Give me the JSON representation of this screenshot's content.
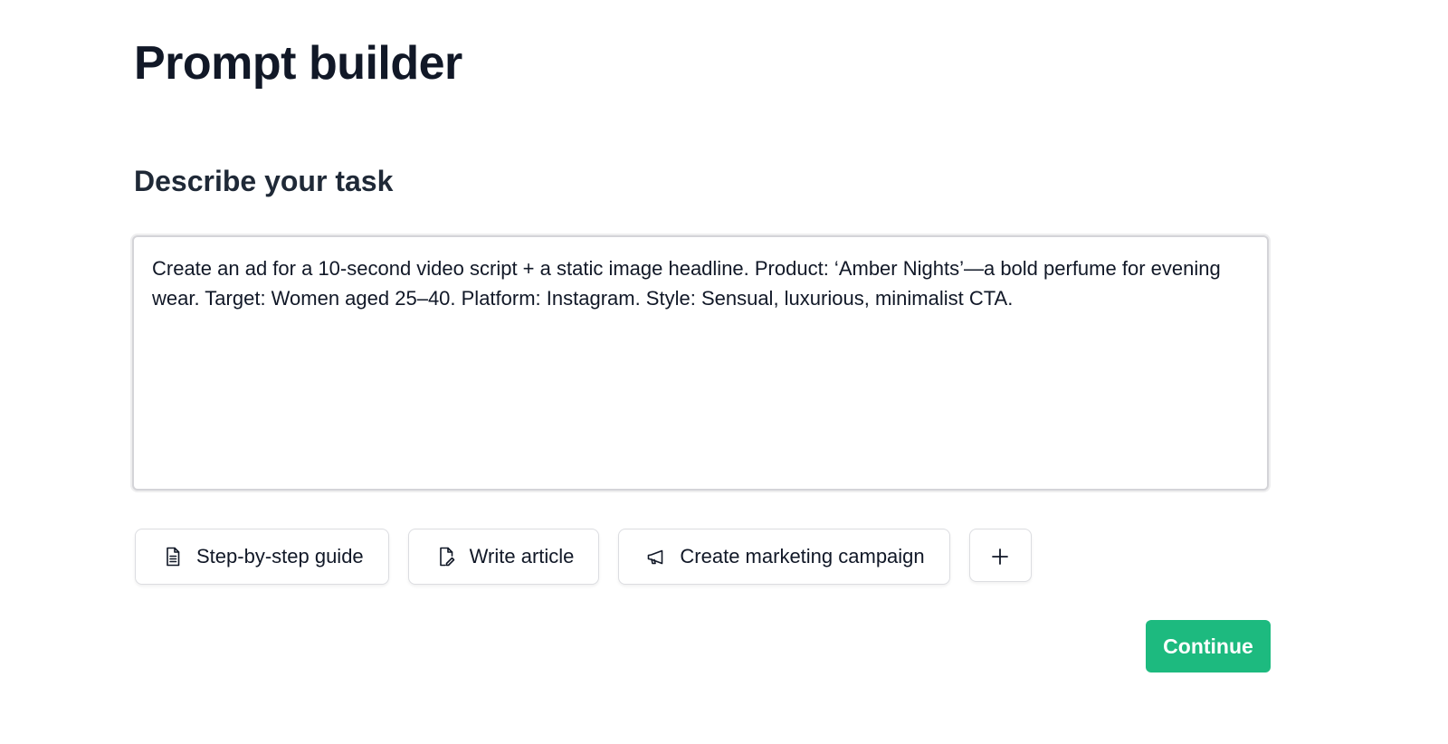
{
  "page": {
    "title": "Prompt builder"
  },
  "task": {
    "heading": "Describe your task",
    "text": "Create an ad for a 10-second video script + a static image headline. Product: ‘Amber Nights’—a bold perfume for evening wear. Target: Women aged 25–40. Platform: Instagram. Style: Sensual, luxurious, minimalist CTA."
  },
  "templates": [
    {
      "label": "Step-by-step guide",
      "icon": "document-lines-icon"
    },
    {
      "label": "Write article",
      "icon": "pen-document-icon"
    },
    {
      "label": "Create marketing campaign",
      "icon": "megaphone-icon"
    }
  ],
  "add_template": {
    "icon": "plus-icon"
  },
  "actions": {
    "continue_label": "Continue"
  },
  "colors": {
    "accent": "#1dba7f",
    "text_primary": "#111827",
    "border": "#d4d4d8"
  }
}
